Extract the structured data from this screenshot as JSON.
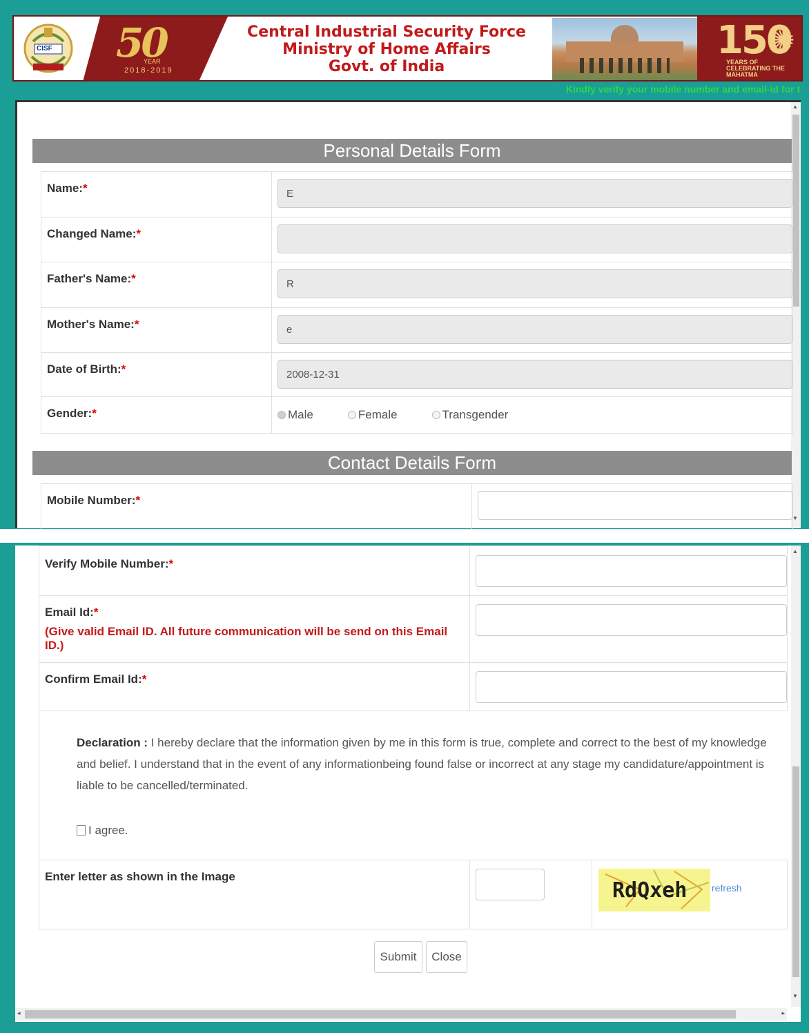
{
  "banner": {
    "line1": "Central Industrial Security Force",
    "line2": "Ministry of Home Affairs",
    "line3": "Govt. of India",
    "emblem_text": "CISF",
    "anniversary_number": "50",
    "anniversary_label": "YEAR",
    "anniversary_years": "2018-2019",
    "mahatma_number": "150",
    "mahatma_caption": "YEARS OF CELEBRATING THE MAHATMA"
  },
  "marquee": "Kindly verify your mobile number and email-id for t",
  "personal": {
    "header": "Personal Details Form",
    "fields": [
      {
        "label": "Name:",
        "value": ""
      },
      {
        "label": "Changed Name:",
        "value": ""
      },
      {
        "label": "Father's Name:",
        "value": "R"
      },
      {
        "label": "Mother's Name:",
        "value": "e"
      },
      {
        "label": "Date of Birth:",
        "value": "2008-12-31"
      }
    ],
    "name_value": "E",
    "gender_label": "Gender:",
    "gender_options": [
      "Male",
      "Female",
      "Transgender"
    ],
    "gender_selected": "Male"
  },
  "required_mark": "*",
  "contact": {
    "header": "Contact Details Form",
    "mobile_label": "Mobile Number:",
    "verify_mobile_label": "Verify Mobile Number:",
    "email_label": "Email Id:",
    "email_note": "(Give valid Email ID. All future communication will be send on this Email ID.)",
    "confirm_email_label": "Confirm Email Id:"
  },
  "declaration": {
    "title": "Declaration :",
    "text": " I hereby declare that the information given by me in this form is true, complete and correct to the best of my knowledge and belief. I understand that in the event of any informationbeing found false or incorrect at any stage my candidature/appointment is liable to be cancelled/terminated.",
    "agree_label": "I agree.",
    "agree_checked": false
  },
  "captcha": {
    "label": "Enter letter as shown in the Image",
    "image_text": "RdQxeh",
    "refresh_label": "refresh",
    "value": ""
  },
  "buttons": {
    "submit": "Submit",
    "close": "Close"
  },
  "colors": {
    "frame": "#1a9e95",
    "section_header": "#8d8d8d",
    "required": "#dd0000",
    "marquee": "#2bd94a",
    "banner_text": "#c11a1a"
  }
}
